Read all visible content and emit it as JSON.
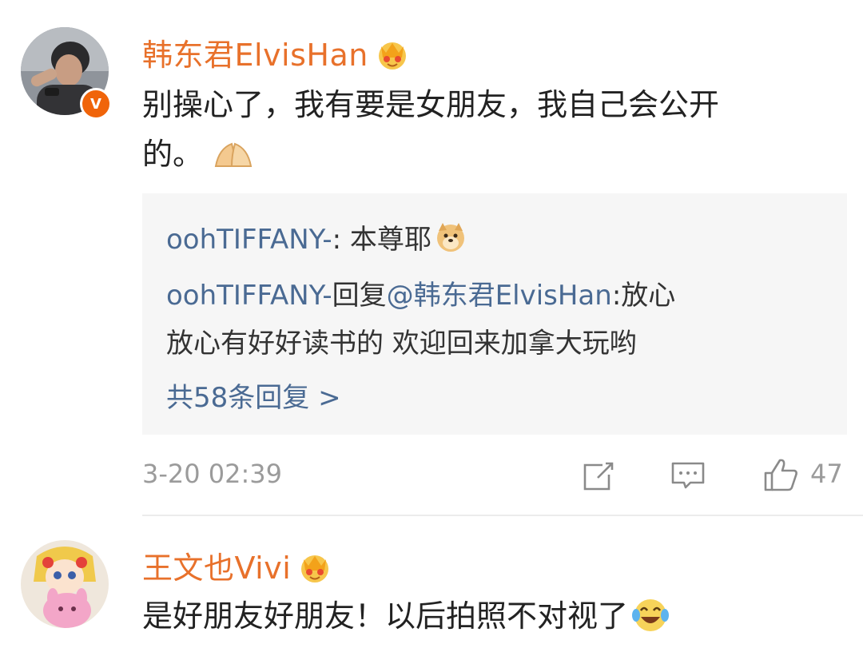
{
  "comments": [
    {
      "username": "韩东君ElvisHan",
      "text_line1": "别操心了，我有要是女朋友，我自己会公开",
      "text_line2": "的。",
      "verified_badge": "V",
      "text_emoji": "pray-icon",
      "replies": [
        {
          "name": "oohTIFFANY-",
          "sep": ": ",
          "text": "本尊耶",
          "emoji": "doge-icon"
        },
        {
          "name": "oohTIFFANY-",
          "reply_word": "回复",
          "mention": "@韩东君ElvisHan",
          "colon": ":",
          "text_line1": "放心",
          "text_line2": "放心有好好读书的 欢迎回来加拿大玩哟"
        }
      ],
      "more_replies": "共58条回复 >",
      "timestamp": "3-20 02:39",
      "like_count": "47"
    },
    {
      "username": "王文也Vivi",
      "text": "是好朋友好朋友！以后拍照不对视了",
      "text_emoji": "laugh-cry-icon"
    }
  ],
  "colors": {
    "username": "#e8712b",
    "reply_name": "#4a6a93",
    "meta": "#9b9b9b",
    "reply_bg": "#f6f6f6",
    "verified": "#f0640a"
  }
}
